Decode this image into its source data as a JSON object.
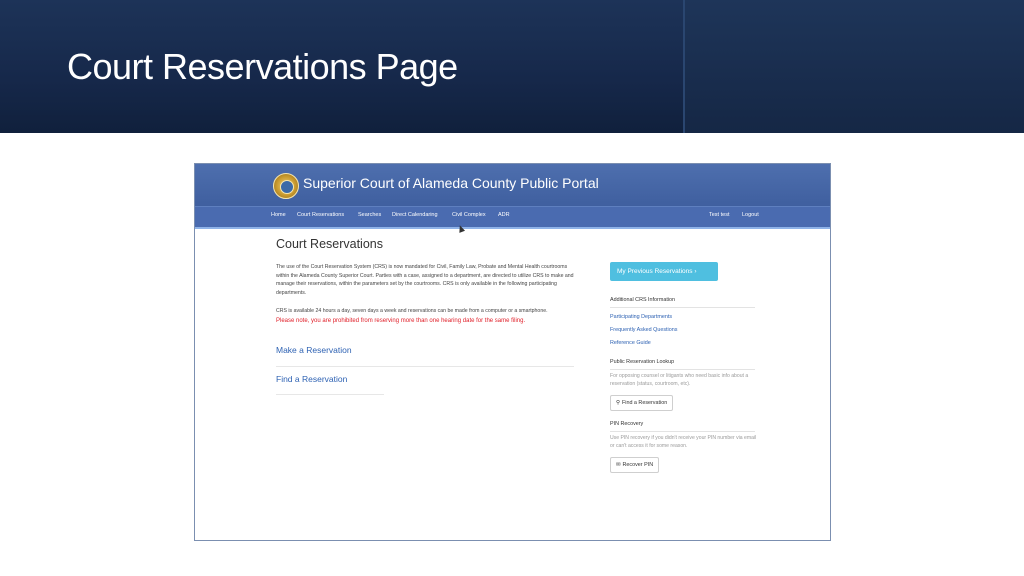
{
  "slide": {
    "title": "Court Reservations Page"
  },
  "portal": {
    "name": "Superior Court of Alameda County Public Portal",
    "nav": [
      "Home",
      "Court Reservations",
      "Searches",
      "Direct Calendaring",
      "Civil Complex",
      "ADR"
    ],
    "user": "Test test",
    "logout": "Logout"
  },
  "main": {
    "title": "Court Reservations",
    "intro": "The use of the Court Reservation System (CRS) is now mandated for Civil, Family Law, Probate and Mental Health courtrooms within the Alameda County Superior Court. Parties with a case, assigned to a department, are directed to utilize CRS to make and manage their reservations, within the parameters set by the courtrooms. CRS is only available in the following participating departments.",
    "availability": "CRS is available 24 hours a day, seven days a week and reservations can be made from a computer or a smartphone.",
    "warning": "Please note, you are prohibited from reserving more than one hearing date for the same filing.",
    "make_link": "Make a Reservation",
    "find_link": "Find a Reservation"
  },
  "sidebar": {
    "prev_button": "My Previous Reservations",
    "additional_heading": "Additional CRS Information",
    "links": [
      "Participating Departments",
      "Frequently Asked Questions",
      "Reference Guide"
    ],
    "lookup_heading": "Public Reservation Lookup",
    "lookup_text": "For opposing counsel or litigants who need basic info about a reservation (status, courtroom, etc).",
    "lookup_button": "Find a Reservation",
    "pin_heading": "PIN Recovery",
    "pin_text": "Use PIN recovery if you didn't receive your PIN number via email or can't access it for some reason.",
    "pin_button": "Recover PIN"
  }
}
